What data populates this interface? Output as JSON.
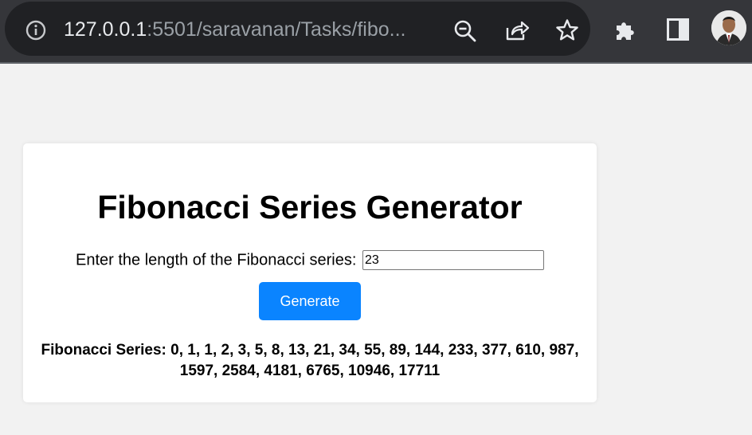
{
  "browser": {
    "url_host": "127.0.0.1",
    "url_rest": ":5501/saravanan/Tasks/fibo...",
    "icons": [
      "info-icon",
      "zoom-out-icon",
      "share-icon",
      "star-icon",
      "puzzle-icon",
      "side-panel-icon",
      "avatar"
    ]
  },
  "app": {
    "title": "Fibonacci Series Generator",
    "input_label": "Enter the length of the Fibonacci series:",
    "input_value": "23",
    "button_label": "Generate",
    "result_text": "Fibonacci Series: 0, 1, 1, 2, 3, 5, 8, 13, 21, 34, 55, 89, 144, 233, 377, 610, 987, 1597, 2584, 4181, 6765, 10946, 17711"
  },
  "colors": {
    "button": "#0a84ff",
    "page_bg": "#f2f2f2",
    "browser_bar": "#35363a"
  }
}
